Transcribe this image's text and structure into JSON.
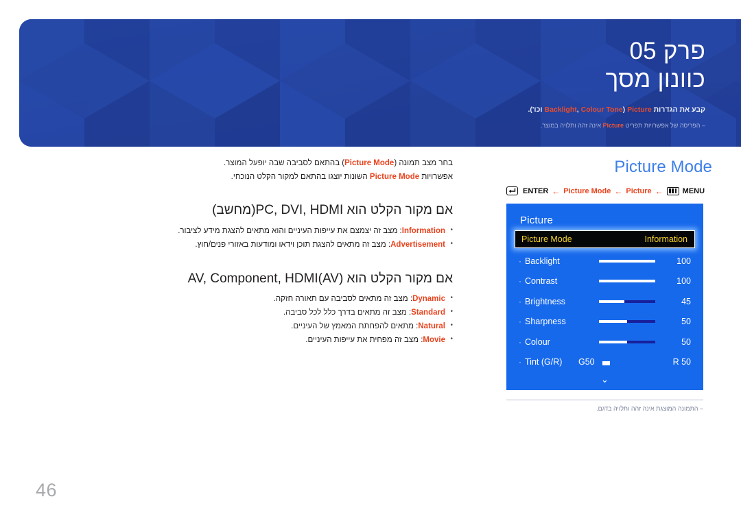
{
  "banner": {
    "chapter_label": "פרק 05",
    "chapter_title": "כוונון מסך",
    "subtitle_prefix": "קבע את הגדרות ",
    "subtitle_term1": "Picture",
    "subtitle_mid": " (",
    "subtitle_term2": "Backlight",
    "subtitle_comma": ", ",
    "subtitle_term3": "Colour Tone",
    "subtitle_suffix": " וכו').",
    "note_prefix": "–  הפריסה של אפשרויות תפריט ",
    "note_term": "Picture",
    "note_suffix": " אינה זהה ותלויה במוצר.",
    "bg_color": "#23409a"
  },
  "left": {
    "intro": {
      "line1_a": "בחר מצב תמונה (",
      "line1_term": "Picture Mode",
      "line1_b": ") בהתאם לסביבה שבה יופעל המוצר.",
      "line2_a": "אפשרויות ",
      "line2_term": "Picture Mode",
      "line2_b": " השונות יוצגו בהתאם למקור הקלט הנוכחי."
    },
    "section1": {
      "heading": "אם מקור הקלט הוא PC, DVI, HDMI(מחשב)",
      "bullets": [
        {
          "term": "Information",
          "text": ": מצב זה יצמצם את עייפות העיניים והוא מתאים להצגת מידע לציבור."
        },
        {
          "term": "Advertisement",
          "text": ": מצב זה מתאים להצגת תוכן וידאו ומודעות באזורי פנים/חוץ."
        }
      ]
    },
    "section2": {
      "heading": "אם מקור הקלט הוא AV, Component, HDMI(AV)",
      "bullets": [
        {
          "term": "Dynamic",
          "text": ": מצב זה מתאים לסביבה עם תאורה חזקה."
        },
        {
          "term": "Standard",
          "text": ": מצב זה מתאים בדרך כלל לכל סביבה."
        },
        {
          "term": "Natural",
          "text": ": מתאים להפחתת המאמץ של העיניים."
        },
        {
          "term": "Movie",
          "text": ": מצב זה מפחית את עייפות העיניים."
        }
      ]
    }
  },
  "right": {
    "title": "Picture Mode",
    "title_color": "#3d7fe8",
    "breadcrumb": {
      "enter_label": "ENTER",
      "arrow": "←",
      "step1": "Picture Mode",
      "step2": "Picture",
      "menu_label": "MENU",
      "accent_color": "#e8441f"
    },
    "osd": {
      "panel_color": "#1769ec",
      "title": "Picture",
      "selected": {
        "label": "Picture Mode",
        "value": "Information",
        "text_color": "#f5d22a"
      },
      "rows": [
        {
          "name": "Backlight",
          "value": "100",
          "fill_pct": 100
        },
        {
          "name": "Contrast",
          "value": "100",
          "fill_pct": 100
        },
        {
          "name": "Brightness",
          "value": "45",
          "fill_pct": 45
        },
        {
          "name": "Sharpness",
          "value": "50",
          "fill_pct": 50
        },
        {
          "name": "Colour",
          "value": "50",
          "fill_pct": 50
        }
      ],
      "tint": {
        "name": "Tint (G/R)",
        "left_label": "G50",
        "right_label": "R 50",
        "thumb_pct": 42
      },
      "scroll_down_glyph": "⌄"
    },
    "footnote": "–  התמונה המוצגת אינה זהה ותלויה בדגם."
  },
  "page_number": "46"
}
